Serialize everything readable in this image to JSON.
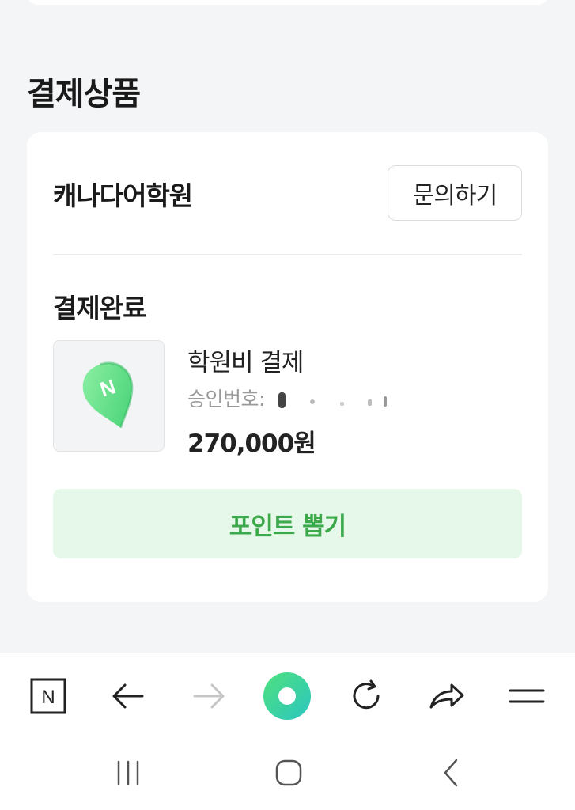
{
  "section": {
    "title": "결제상품"
  },
  "card": {
    "store_name": "캐나다어학원",
    "inquiry_label": "문의하기",
    "status": "결제완료",
    "product": {
      "title": "학원비 결제",
      "approval_label": "승인번호:",
      "price": "270,000원",
      "thumbnail_icon": "naver-pin-icon"
    },
    "point_button_label": "포인트 뽑기"
  },
  "browser_toolbar": {
    "items": [
      "naver-home-icon",
      "back-arrow-icon",
      "forward-arrow-icon",
      "green-dot-icon",
      "refresh-icon",
      "share-icon",
      "menu-icon"
    ],
    "home_letter": "N"
  },
  "system_nav": {
    "items": [
      "recent-apps-icon",
      "home-icon",
      "back-icon"
    ]
  },
  "colors": {
    "accent_green": "#3ca94a",
    "point_bg": "#e6f8e9",
    "page_bg": "#f4f5f7"
  }
}
